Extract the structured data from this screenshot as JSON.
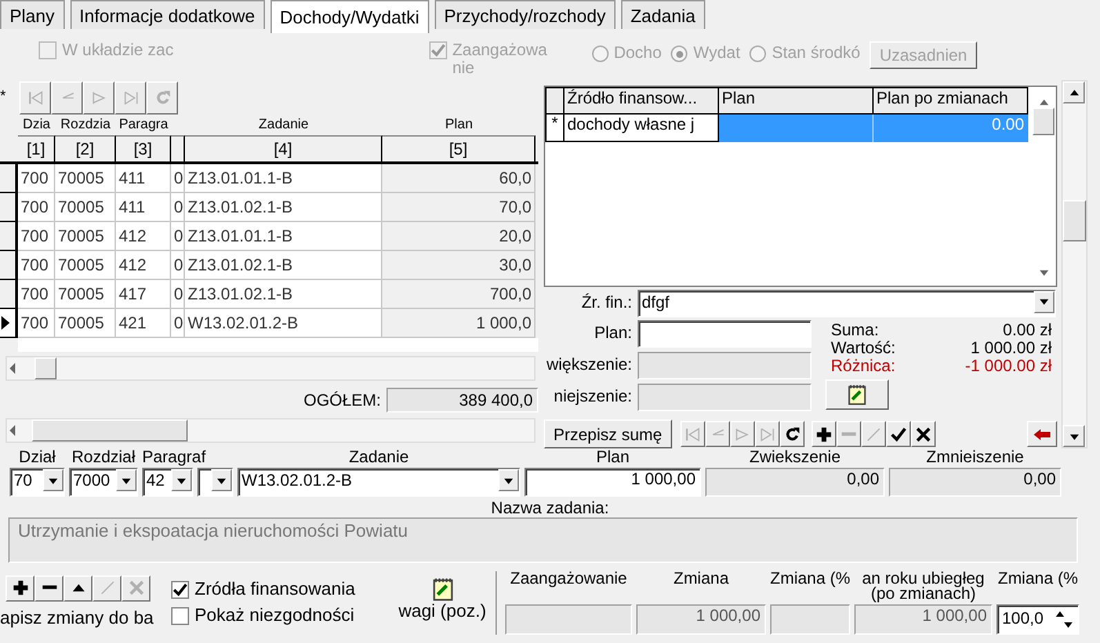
{
  "tabs": [
    {
      "label": "Plany",
      "selected": false
    },
    {
      "label": "Informacje dodatkowe",
      "selected": false
    },
    {
      "label": "Dochody/Wydatki",
      "selected": true
    },
    {
      "label": "Przychody/rozchody",
      "selected": false
    },
    {
      "label": "Zadania",
      "selected": false
    }
  ],
  "options": {
    "checkboxes": [
      {
        "label": "W układzie zac",
        "checked": false,
        "disabled": true
      },
      {
        "label": "Zaangażowa nie",
        "checked": true,
        "disabled": true
      }
    ],
    "radios": [
      {
        "label": "Docho",
        "selected": false,
        "disabled": true
      },
      {
        "label": "Wydat",
        "selected": true,
        "disabled": true
      },
      {
        "label": "Stan środkó",
        "selected": false,
        "disabled": true
      }
    ],
    "button": {
      "label": "Uzasadnien",
      "disabled": true
    }
  },
  "plan_grid": {
    "nav_buttons": [
      {
        "kind": "first",
        "disabled": true
      },
      {
        "kind": "prev",
        "disabled": true
      },
      {
        "kind": "next",
        "disabled": true
      },
      {
        "kind": "last",
        "disabled": true
      },
      {
        "kind": "refresh",
        "disabled": true
      }
    ],
    "new_row_marker": "*",
    "columns": [
      {
        "title": "Dzia",
        "index": "[1]"
      },
      {
        "title": "Rozdzia",
        "index": "[2]"
      },
      {
        "title": "Paragra",
        "index": "[3]"
      },
      {},
      {
        "title": "Zadanie",
        "index": "[4]"
      },
      {
        "title": "Plan",
        "index": "[5]"
      }
    ],
    "rows": [
      {
        "cells": [
          "700",
          "70005",
          "411",
          "0",
          "Z13.01.01.1-B",
          "60,0"
        ],
        "current": false
      },
      {
        "cells": [
          "700",
          "70005",
          "411",
          "0",
          "Z13.01.02.1-B",
          "70,0"
        ],
        "current": false
      },
      {
        "cells": [
          "700",
          "70005",
          "412",
          "0",
          "Z13.01.01.1-B",
          "20,0"
        ],
        "current": false
      },
      {
        "cells": [
          "700",
          "70005",
          "412",
          "0",
          "Z13.01.02.1-B",
          "30,0"
        ],
        "current": false
      },
      {
        "cells": [
          "700",
          "70005",
          "417",
          "0",
          "Z13.01.02.1-B",
          "700,0"
        ],
        "current": false
      },
      {
        "cells": [
          "700",
          "70005",
          "421",
          "0",
          "W13.02.01.2-B",
          "1 000,0"
        ],
        "current": true
      }
    ],
    "total": {
      "label": "OGÓŁEM:",
      "value": "389 400,0"
    }
  },
  "source_grid": {
    "columns": [
      "Źródło finansow...",
      "Plan",
      "Plan po zmianach"
    ],
    "rows": [
      {
        "marker": "*",
        "source": "dochody własne j",
        "plan_after": "0.00",
        "selected": true
      }
    ]
  },
  "source_form": {
    "source": {
      "label": "Źr. fin.:",
      "value": "dfgf"
    },
    "fields": [
      {
        "label": "Plan:",
        "disabled": false
      },
      {
        "label": "większenie:",
        "disabled": true
      },
      {
        "label": "niejszenie:",
        "disabled": true
      }
    ],
    "summary": [
      {
        "label": "Suma:",
        "value": "0.00 zł",
        "color": "#000000"
      },
      {
        "label": "Wartość:",
        "value": "1 000.00 zł",
        "color": "#000000"
      },
      {
        "label": "Różnica:",
        "value": "-1 000.00 zł",
        "color": "#c00000"
      }
    ],
    "copy_button": "Przepisz sumę",
    "toolbar": [
      {
        "kind": "first",
        "disabled": true
      },
      {
        "kind": "prev",
        "disabled": true
      },
      {
        "kind": "next",
        "disabled": true
      },
      {
        "kind": "last",
        "disabled": true
      },
      {
        "kind": "refresh",
        "disabled": false
      },
      {
        "kind": "add",
        "disabled": false
      },
      {
        "kind": "remove",
        "disabled": true
      },
      {
        "kind": "edit",
        "disabled": true
      },
      {
        "kind": "accept",
        "disabled": false
      },
      {
        "kind": "cancel",
        "disabled": false
      }
    ]
  },
  "detail": {
    "fields": [
      {
        "label": "Dział",
        "value": "70",
        "kind": "combo",
        "disabled": false
      },
      {
        "label": "Rozdział",
        "value": "7000",
        "kind": "combo",
        "disabled": false
      },
      {
        "label": "Paragraf",
        "value": "42",
        "kind": "combo",
        "disabled": false
      },
      {
        "kind": "combo",
        "disabled": false
      },
      {
        "label": "Zadanie",
        "value": "W13.02.01.2-B",
        "kind": "combo",
        "disabled": false
      },
      {
        "label": "Plan",
        "value": "1 000,00",
        "kind": "text",
        "disabled": false
      },
      {
        "label": "Zwiekszenie",
        "value": "0,00",
        "kind": "text",
        "disabled": true
      },
      {
        "label": "Zmnieiszenie",
        "value": "0,00",
        "kind": "text",
        "disabled": true
      }
    ],
    "name": {
      "label": "Nazwa zadania:",
      "value": "Utrzymanie i ekspoatacja nieruchomości Powiatu"
    }
  },
  "bottom": {
    "buttons": [
      {
        "kind": "add",
        "disabled": false
      },
      {
        "kind": "remove",
        "disabled": false
      },
      {
        "kind": "up",
        "disabled": false
      },
      {
        "kind": "edit",
        "disabled": true
      },
      {
        "kind": "cancel",
        "disabled": true
      }
    ],
    "save_label": "apisz zmiany do ba",
    "checkboxes": [
      {
        "label": "Zródła finansowania",
        "checked": true
      },
      {
        "label": "Pokaż niezgodności",
        "checked": false
      }
    ],
    "notes_button": "wagi (poz.)",
    "fields": [
      {
        "label": "Zaangażowanie",
        "kind": "text"
      },
      {
        "label": "Zmiana",
        "value": "1 000,00",
        "kind": "text"
      },
      {
        "label": "Zmiana (%",
        "kind": "text"
      },
      {
        "label": "an roku ubiegłeg (po zmianach)",
        "value": "1 000,00",
        "kind": "text"
      },
      {
        "label": "Zmiana (%",
        "value": "100,0",
        "kind": "spin"
      }
    ]
  }
}
